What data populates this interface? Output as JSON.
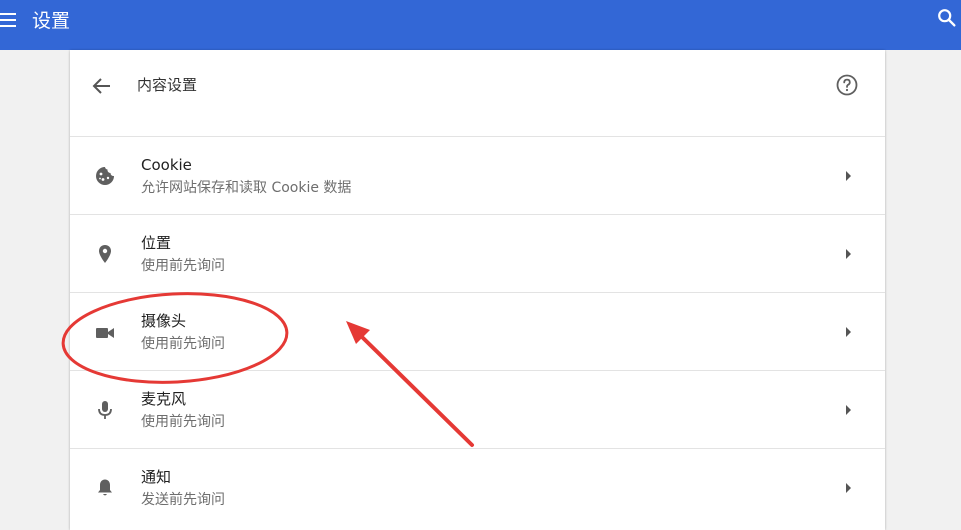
{
  "header": {
    "title": "设置",
    "background_color": "#3367d6",
    "menu_icon": "hamburger-menu-icon",
    "search_icon": "search-icon"
  },
  "content": {
    "title": "内容设置",
    "back_icon": "arrow-left-icon",
    "help_icon": "help-circle-icon",
    "rows": [
      {
        "icon": "cookie-icon",
        "title": "Cookie",
        "subtitle": "允许网站保存和读取 Cookie 数据"
      },
      {
        "icon": "location-pin-icon",
        "title": "位置",
        "subtitle": "使用前先询问"
      },
      {
        "icon": "camera-icon",
        "title": "摄像头",
        "subtitle": "使用前先询问"
      },
      {
        "icon": "microphone-icon",
        "title": "麦克风",
        "subtitle": "使用前先询问"
      },
      {
        "icon": "notification-bell-icon",
        "title": "通知",
        "subtitle": "发送前先询问"
      }
    ]
  },
  "annotation": {
    "color": "#e53935",
    "highlighted_item": "摄像头"
  }
}
